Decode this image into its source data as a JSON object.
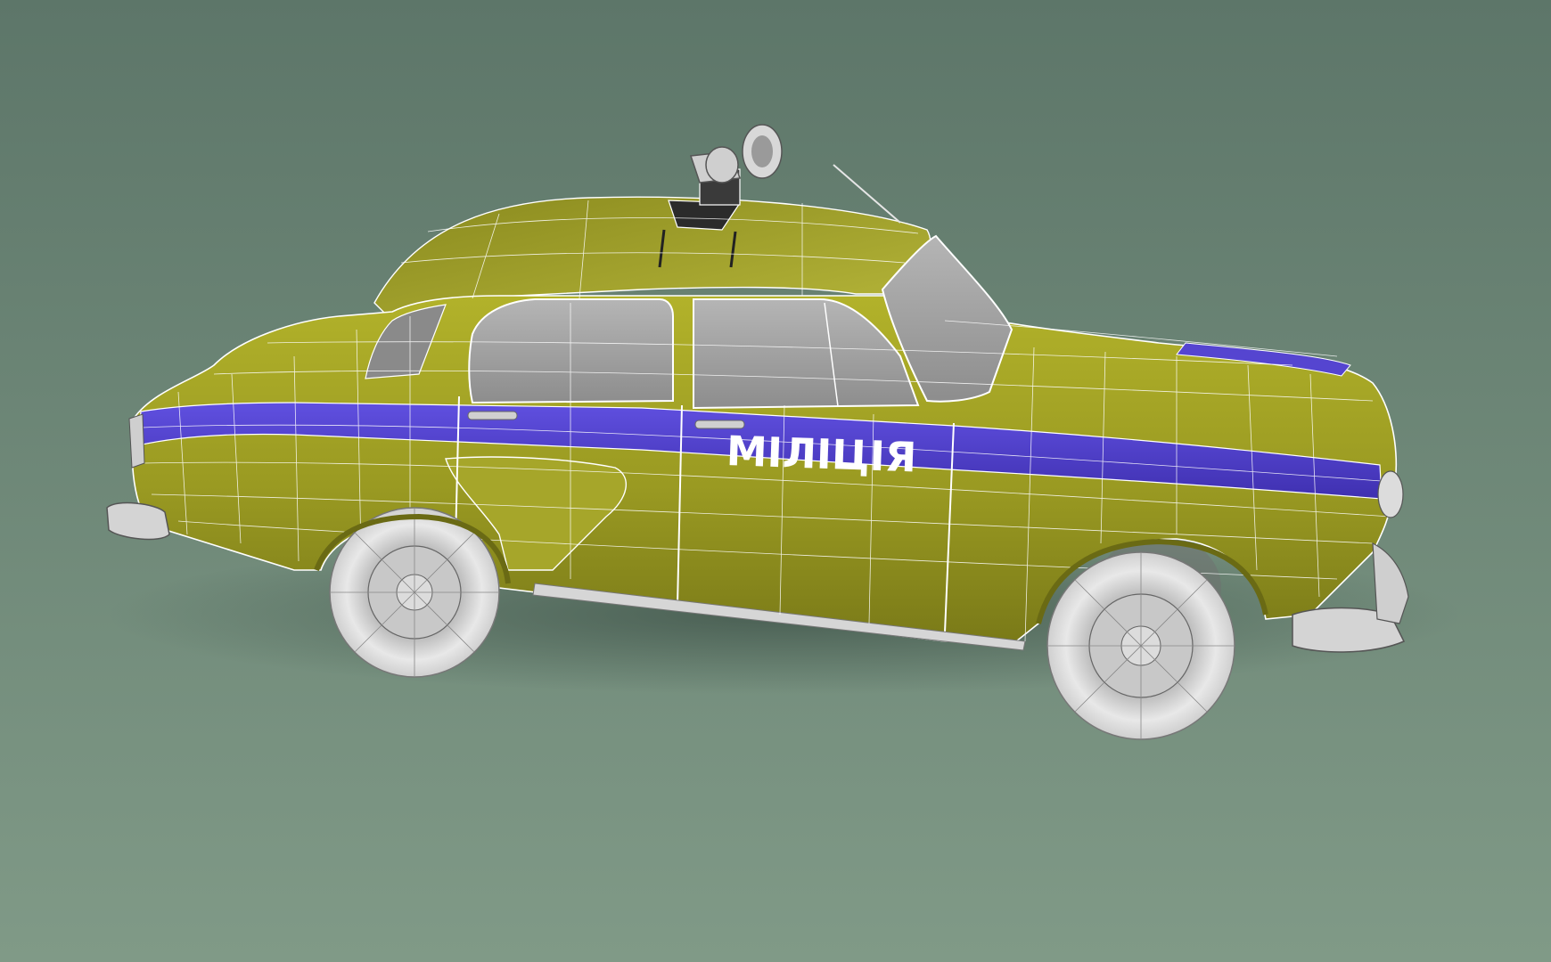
{
  "scene": {
    "kind": "3d-wireframe-render",
    "subject": "car",
    "door_text": "МІЛІЦІЯ",
    "colors": {
      "background_top": "#5f7a6c",
      "background_bottom": "#7e9885",
      "body": "#9a9a22",
      "body_dark": "#7f801a",
      "stripe": "#4f3fc7",
      "glass": "#9e9e9e",
      "chrome": "#cfcfcf",
      "tire": "#e3e3e3",
      "wire": "#ffffff",
      "shadow": "#4a5e52"
    }
  }
}
